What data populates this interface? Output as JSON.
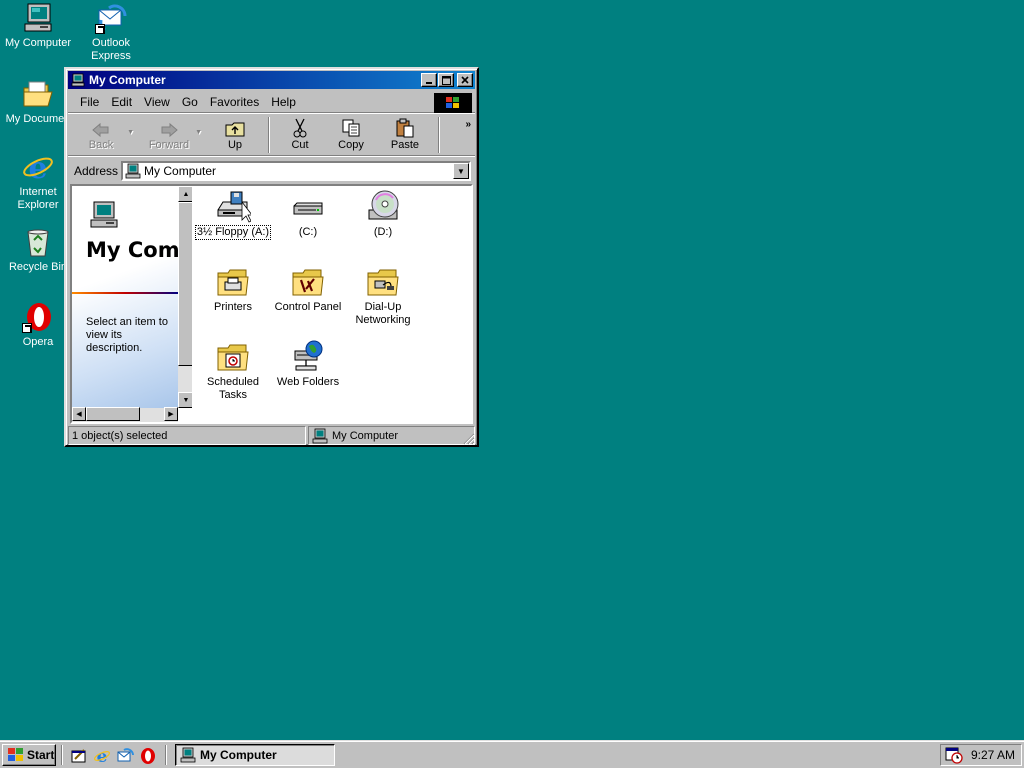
{
  "desktop": {
    "icons": [
      {
        "name": "my-computer",
        "label": "My Computer"
      },
      {
        "name": "outlook-express",
        "label": "Outlook\nExpress"
      },
      {
        "name": "my-documents",
        "label": "My Documen"
      },
      {
        "name": "internet-explorer",
        "label": "Internet\nExplorer"
      },
      {
        "name": "recycle-bin",
        "label": "Recycle Bin"
      },
      {
        "name": "opera",
        "label": "Opera"
      }
    ]
  },
  "window": {
    "title": "My Computer",
    "menu": [
      "File",
      "Edit",
      "View",
      "Go",
      "Favorites",
      "Help"
    ],
    "toolbar": {
      "back": "Back",
      "forward": "Forward",
      "up": "Up",
      "cut": "Cut",
      "copy": "Copy",
      "paste": "Paste",
      "more": "»"
    },
    "address": {
      "label": "Address",
      "value": "My Computer"
    },
    "left_pane": {
      "title": "My Comput",
      "description": "Select an item to view its description."
    },
    "items": [
      {
        "name": "floppy-a",
        "label": "3½ Floppy (A:)",
        "selected": true
      },
      {
        "name": "drive-c",
        "label": "(C:)"
      },
      {
        "name": "drive-d",
        "label": "(D:)"
      },
      {
        "name": "printers",
        "label": "Printers"
      },
      {
        "name": "control-panel",
        "label": "Control Panel"
      },
      {
        "name": "dial-up-networking",
        "label": "Dial-Up\nNetworking"
      },
      {
        "name": "scheduled-tasks",
        "label": "Scheduled\nTasks"
      },
      {
        "name": "web-folders",
        "label": "Web Folders"
      }
    ],
    "status": {
      "left": "1 object(s) selected",
      "right": "My Computer"
    }
  },
  "taskbar": {
    "start_label": "Start",
    "task_label": "My Computer",
    "clock": "9:27 AM"
  },
  "colors": {
    "desktop": "#008080",
    "titlebar_start": "#000080",
    "titlebar_end": "#1084d0",
    "face": "#c0c0c0"
  }
}
